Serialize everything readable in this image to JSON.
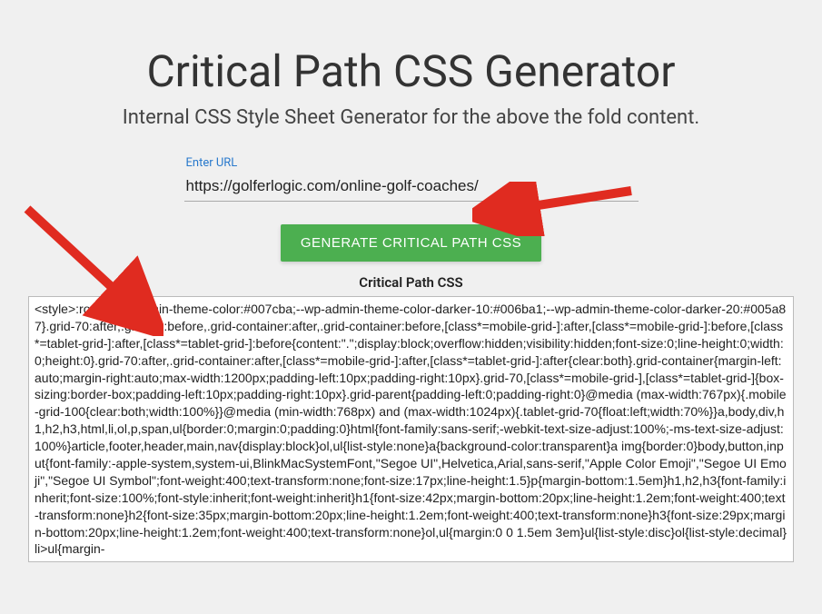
{
  "heading": "Critical Path CSS Generator",
  "subtitle": "Internal CSS Style Sheet Generator for the above the fold content.",
  "form": {
    "url_label": "Enter URL",
    "url_value": "https://golferlogic.com/online-golf-coaches/",
    "button_label": "GENERATE CRITICAL PATH CSS",
    "output_label": "Critical Path CSS"
  },
  "output_css": "<style>:root{--wp-admin-theme-color:#007cba;--wp-admin-theme-color-darker-10:#006ba1;--wp-admin-theme-color-darker-20:#005a87}.grid-70:after,.grid-70:before,.grid-container:after,.grid-container:before,[class*=mobile-grid-]:after,[class*=mobile-grid-]:before,[class*=tablet-grid-]:after,[class*=tablet-grid-]:before{content:\".\";display:block;overflow:hidden;visibility:hidden;font-size:0;line-height:0;width:0;height:0}.grid-70:after,.grid-container:after,[class*=mobile-grid-]:after,[class*=tablet-grid-]:after{clear:both}.grid-container{margin-left:auto;margin-right:auto;max-width:1200px;padding-left:10px;padding-right:10px}.grid-70,[class*=mobile-grid-],[class*=tablet-grid-]{box-sizing:border-box;padding-left:10px;padding-right:10px}.grid-parent{padding-left:0;padding-right:0}@media (max-width:767px){.mobile-grid-100{clear:both;width:100%}}@media (min-width:768px) and (max-width:1024px){.tablet-grid-70{float:left;width:70%}}a,body,div,h1,h2,h3,html,li,ol,p,span,ul{border:0;margin:0;padding:0}html{font-family:sans-serif;-webkit-text-size-adjust:100%;-ms-text-size-adjust:100%}article,footer,header,main,nav{display:block}ol,ul{list-style:none}a{background-color:transparent}a img{border:0}body,button,input{font-family:-apple-system,system-ui,BlinkMacSystemFont,\"Segoe UI\",Helvetica,Arial,sans-serif,\"Apple Color Emoji\",\"Segoe UI Emoji\",\"Segoe UI Symbol\";font-weight:400;text-transform:none;font-size:17px;line-height:1.5}p{margin-bottom:1.5em}h1,h2,h3{font-family:inherit;font-size:100%;font-style:inherit;font-weight:inherit}h1{font-size:42px;margin-bottom:20px;line-height:1.2em;font-weight:400;text-transform:none}h2{font-size:35px;margin-bottom:20px;line-height:1.2em;font-weight:400;text-transform:none}h3{font-size:29px;margin-bottom:20px;line-height:1.2em;font-weight:400;text-transform:none}ol,ul{margin:0 0 1.5em 3em}ul{list-style:disc}ol{list-style:decimal}li>ul{margin-"
}
